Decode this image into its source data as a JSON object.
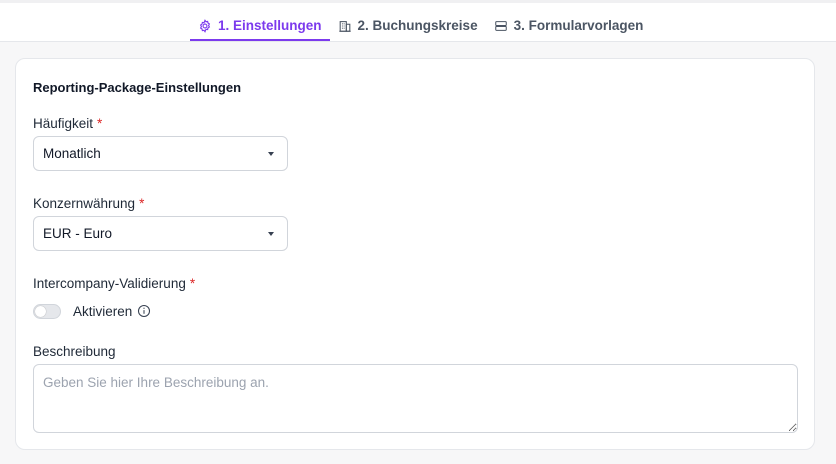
{
  "tabs": [
    {
      "label": "1. Einstellungen",
      "icon": "gear-icon",
      "active": true
    },
    {
      "label": "2. Buchungskreise",
      "icon": "building-icon",
      "active": false
    },
    {
      "label": "3. Formularvorlagen",
      "icon": "template-icon",
      "active": false
    }
  ],
  "colors": {
    "accent": "#7c3aed",
    "required": "#dc2626"
  },
  "card": {
    "title": "Reporting-Package-Einstellungen",
    "frequency": {
      "label": "Häufigkeit",
      "required_mark": "*",
      "value": "Monatlich"
    },
    "currency": {
      "label": "Konzernwährung",
      "required_mark": "*",
      "value": "EUR - Euro"
    },
    "intercompany": {
      "label": "Intercompany-Validierung",
      "required_mark": "*",
      "toggle_label": "Aktivieren",
      "enabled": false
    },
    "description": {
      "label": "Beschreibung",
      "placeholder": "Geben Sie hier Ihre Beschreibung an.",
      "value": ""
    }
  }
}
